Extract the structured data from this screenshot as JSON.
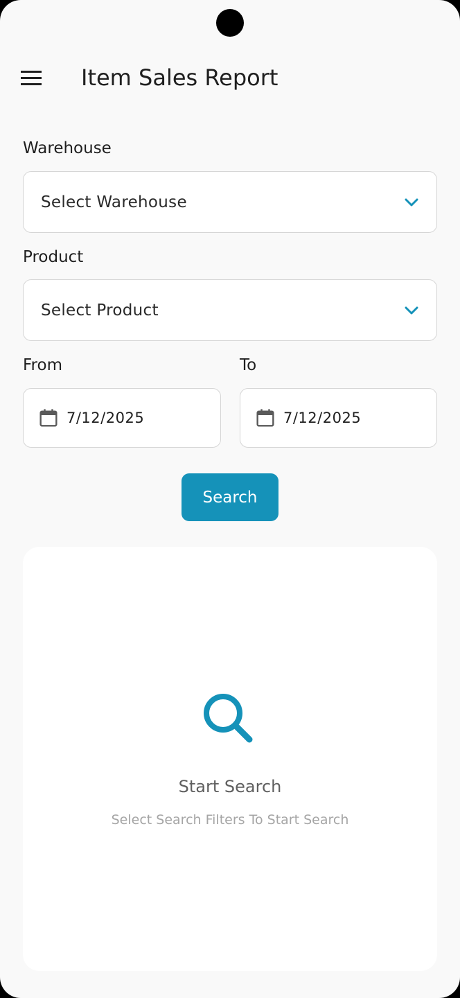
{
  "app_bar": {
    "menu_icon": "hamburger-menu-icon",
    "title": "Item Sales Report"
  },
  "form": {
    "warehouse": {
      "label": "Warehouse",
      "placeholder": "Select Warehouse",
      "icon": "chevron-down-icon"
    },
    "product": {
      "label": "Product",
      "placeholder": "Select Product",
      "icon": "chevron-down-icon"
    },
    "from": {
      "label": "From",
      "value": "7/12/2025",
      "icon": "calendar-icon"
    },
    "to": {
      "label": "To",
      "value": "7/12/2025",
      "icon": "calendar-icon"
    },
    "search_button": "Search"
  },
  "results": {
    "empty_icon": "search-icon",
    "empty_title": "Start Search",
    "empty_subtitle": "Select Search Filters To Start Search"
  },
  "colors": {
    "accent": "#1592b9",
    "background": "#f9f9f9",
    "card": "#ffffff",
    "border": "#d6d6d6",
    "text_primary": "#1f1f1f",
    "text_secondary": "#5f5f5f",
    "text_muted": "#a5a5a5"
  }
}
